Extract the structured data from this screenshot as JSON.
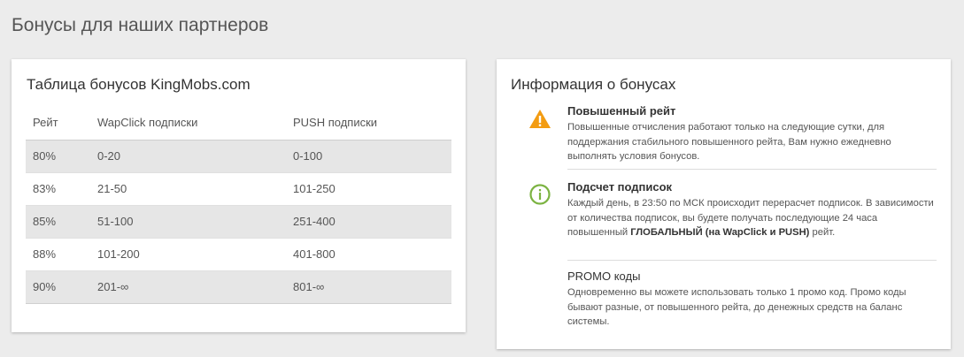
{
  "page": {
    "title": "Бонусы для наших партнеров"
  },
  "bonus_table": {
    "title": "Таблица бонусов KingMobs.com",
    "headers": [
      "Рейт",
      "WapClick подписки",
      "PUSH подписки"
    ],
    "rows": [
      [
        "80%",
        "0-20",
        "0-100"
      ],
      [
        "83%",
        "21-50",
        "101-250"
      ],
      [
        "85%",
        "51-100",
        "251-400"
      ],
      [
        "88%",
        "101-200",
        "401-800"
      ],
      [
        "90%",
        "201-∞",
        "801-∞"
      ]
    ]
  },
  "info": {
    "title": "Информация о бонусах",
    "items": [
      {
        "icon": "warning-icon",
        "icon_color": "#f39c12",
        "title": "Повышенный рейт",
        "text": "Повышенные отчисления работают только на следующие сутки, для поддержания стабильного повышенного рейта, Вам нужно ежедневно выполнять условия бонусов."
      },
      {
        "icon": "info-icon",
        "icon_color": "#7cb342",
        "title": "Подсчет подписок",
        "text_before": "Каждый день, в 23:50 по МСК происходит перерасчет подписок. В зависимости от количества подписок, вы будете получать последующие 24 часа повышенный ",
        "text_bold": "ГЛОБАЛЬНЫЙ (на WapClick и PUSH)",
        "text_after": " рейт."
      },
      {
        "title": "PROMO коды",
        "text": "Одновременно вы можете использовать только 1 промо код. Промо коды бывают разные, от повышенного рейта, до денежных средств на баланс системы."
      }
    ]
  }
}
